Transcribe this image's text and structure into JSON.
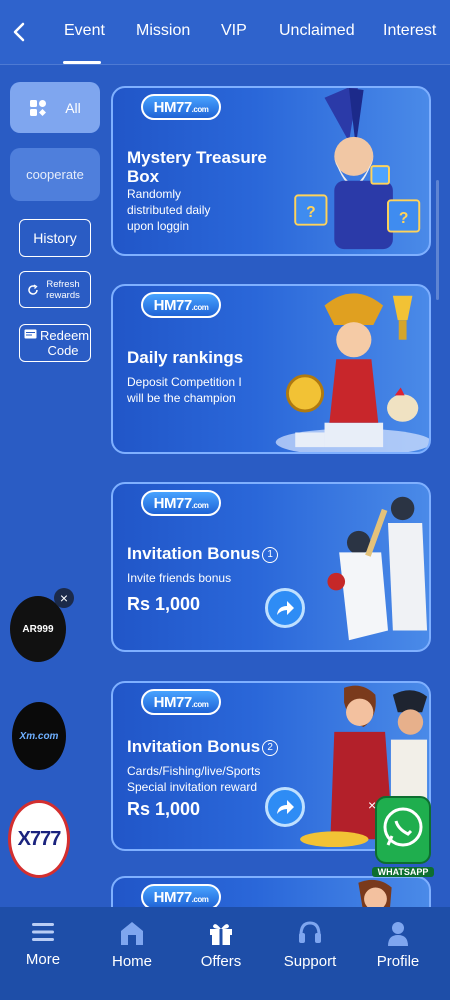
{
  "tabs": [
    {
      "label": "Event",
      "active": true
    },
    {
      "label": "Mission"
    },
    {
      "label": "VIP"
    },
    {
      "label": "Unclaimed"
    },
    {
      "label": "Interest"
    }
  ],
  "sidebar": {
    "all_label": "All",
    "cooperate_label": "cooperate",
    "history_label": "History",
    "refresh_label": "Refresh rewards",
    "redeem_label": "Redeem Code"
  },
  "brand": {
    "logo_main": "HM77",
    "logo_suffix": ".com"
  },
  "cards": [
    {
      "title": "Mystery Treasure Box",
      "desc": "Randomly distributed daily upon loggin"
    },
    {
      "title": "Daily rankings",
      "desc": "Deposit Competition I will be the champion"
    },
    {
      "title": "Invitation Bonus",
      "num": "1",
      "desc": "Invite friends bonus",
      "amount": "Rs 1,000"
    },
    {
      "title": "Invitation Bonus",
      "num": "2",
      "desc": "Cards/Fishing/live/Sports Special invitation reward",
      "amount": "Rs 1,000"
    }
  ],
  "floating": {
    "ar999": "AR999",
    "xm": "Xm.com",
    "x777": "X777",
    "whatsapp": "WHATSAPP"
  },
  "nav": [
    {
      "label": "More"
    },
    {
      "label": "Home"
    },
    {
      "label": "Offers"
    },
    {
      "label": "Support"
    },
    {
      "label": "Profile"
    }
  ],
  "colors": {
    "background": "#2a5cc4",
    "accent": "#7fb0ff",
    "nav": "#1e4ea8"
  }
}
